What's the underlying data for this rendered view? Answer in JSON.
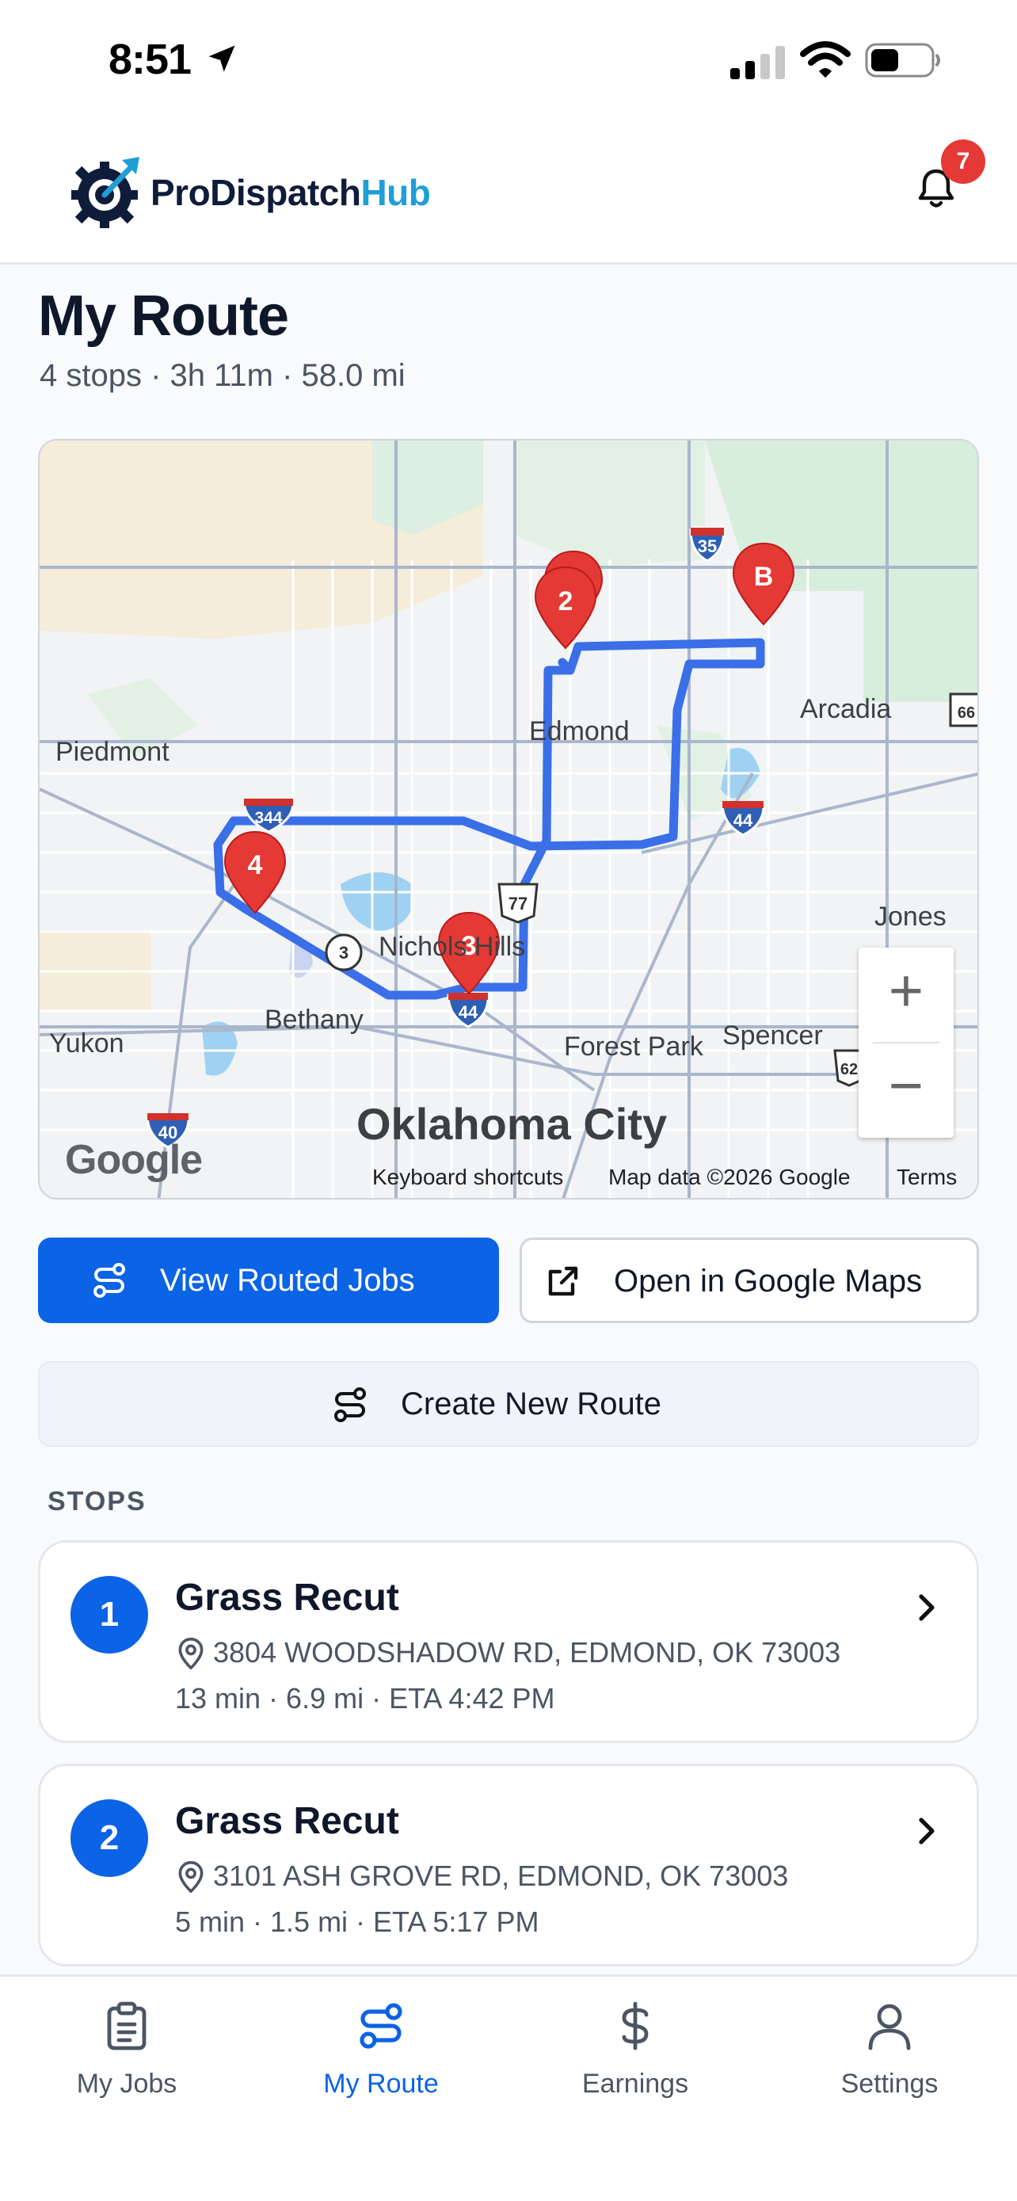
{
  "status_bar": {
    "time": "8:51"
  },
  "header": {
    "brand_part1": "ProDispatch",
    "brand_part2": "Hub",
    "notification_count": "7"
  },
  "page": {
    "title": "My Route",
    "subtitle": "4 stops · 3h 11m · 58.0 mi"
  },
  "map": {
    "labels": {
      "piedmont": "Piedmont",
      "edmond": "Edmond",
      "arcadia": "Arcadia",
      "nichols_hills": "Nichols Hills",
      "bethany": "Bethany",
      "yukon": "Yukon",
      "forest_park": "Forest Park",
      "spencer": "Spencer",
      "jones": "Jones",
      "city": "Oklahoma City"
    },
    "shields": {
      "i35": "35",
      "i344": "344",
      "i44a": "44",
      "i44b": "44",
      "i40": "40",
      "us77": "77",
      "sh3": "3",
      "us62": "62",
      "us66": "66"
    },
    "markers": {
      "m1": "2",
      "mb": "B",
      "m4": "4",
      "m3": "3"
    },
    "zoom_in": "+",
    "zoom_out": "−",
    "google": "Google",
    "keyboard_shortcuts": "Keyboard shortcuts",
    "map_data": "Map data ©2026 Google",
    "terms": "Terms"
  },
  "actions": {
    "view_routed_jobs": "View Routed Jobs",
    "open_google_maps": "Open in Google Maps",
    "create_new_route": "Create New Route"
  },
  "stops": {
    "heading": "STOPS",
    "items": [
      {
        "number": "1",
        "title": "Grass Recut",
        "address": "3804 WOODSHADOW RD, EDMOND, OK 73003",
        "meta": "13 min · 6.9 mi · ETA 4:42 PM"
      },
      {
        "number": "2",
        "title": "Grass Recut",
        "address": "3101 ASH GROVE RD, EDMOND, OK 73003",
        "meta": "5 min · 1.5 mi · ETA 5:17 PM"
      }
    ]
  },
  "nav": {
    "my_jobs": "My Jobs",
    "my_route": "My Route",
    "earnings": "Earnings",
    "settings": "Settings"
  },
  "colors": {
    "primary": "#0b63e5",
    "marker": "#e53935",
    "route": "#3a6fe8",
    "brand_accent": "#1f9ed8"
  }
}
